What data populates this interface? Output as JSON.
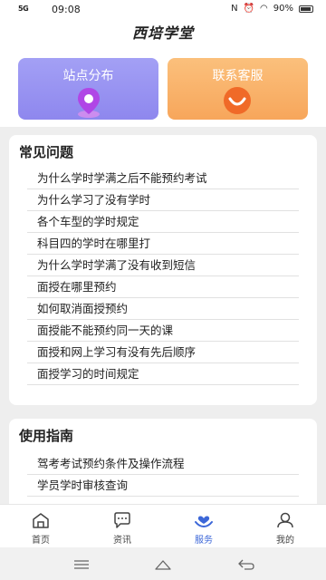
{
  "status": {
    "signal": "5G",
    "time": "09:08",
    "battery": "90%"
  },
  "header": {
    "title": "西培学堂"
  },
  "cards": {
    "station": "站点分布",
    "service": "联系客服"
  },
  "faq": {
    "title": "常见问题",
    "items": [
      "为什么学时学满之后不能预约考试",
      "为什么学习了没有学时",
      "各个车型的学时规定",
      "科目四的学时在哪里打",
      "为什么学时学满了没有收到短信",
      "面授在哪里预约",
      "如何取消面授预约",
      "面授能不能预约同一天的课",
      "面授和网上学习有没有先后顺序",
      "面授学习的时间规定"
    ]
  },
  "guide": {
    "title": "使用指南",
    "items": [
      "驾考考试预约条件及操作流程",
      "学员学时审核查询"
    ]
  },
  "tabs": {
    "home": "首页",
    "news": "资讯",
    "service": "服务",
    "mine": "我的"
  },
  "colors": {
    "active": "#3c67d8",
    "station_card": "#968ff0",
    "service_card": "#f9b06a"
  }
}
